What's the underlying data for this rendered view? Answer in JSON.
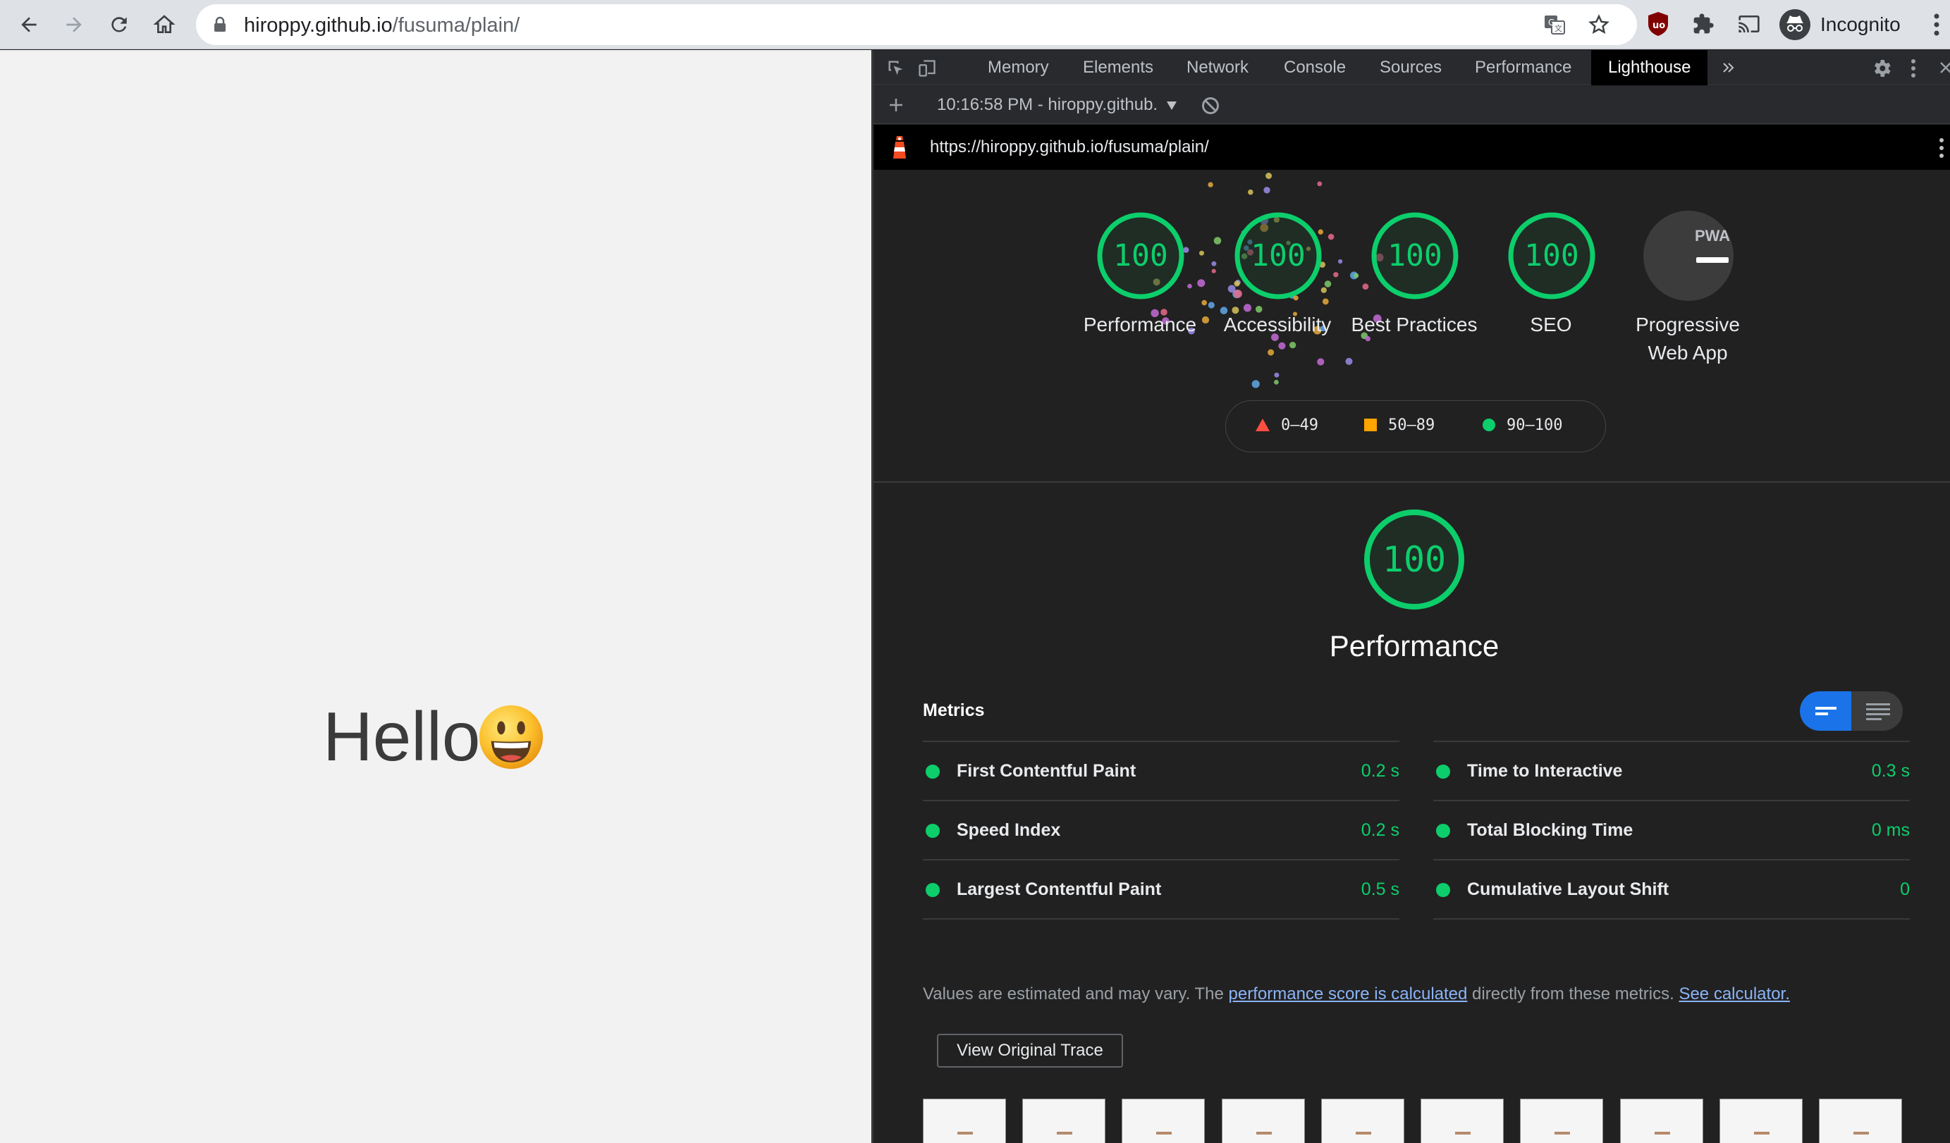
{
  "browser": {
    "url_host": "hiroppy.github.io",
    "url_path": "/fusuma/plain/",
    "profile_label": "Incognito"
  },
  "page": {
    "greeting": "Hello",
    "emoji_icon": "grinning-face-icon"
  },
  "devtools": {
    "tabs": [
      {
        "label": "Memory"
      },
      {
        "label": "Elements"
      },
      {
        "label": "Network"
      },
      {
        "label": "Console"
      },
      {
        "label": "Sources"
      },
      {
        "label": "Performance"
      },
      {
        "label": "Lighthouse",
        "active": true
      }
    ],
    "report_selector": "10:16:58 PM - hiroppy.github.",
    "lighthouse_url": "https://hiroppy.github.io/fusuma/plain/"
  },
  "lighthouse": {
    "gauges": [
      {
        "score": "100",
        "label": "Performance"
      },
      {
        "score": "100",
        "label": "Accessibility"
      },
      {
        "score": "100",
        "label": "Best Practices"
      },
      {
        "score": "100",
        "label": "SEO"
      },
      {
        "score": null,
        "label": "Progressive Web App",
        "badge_text": "PWA"
      }
    ],
    "legend": [
      {
        "range": "0–49",
        "shape": "triangle",
        "color": "#ff4e42"
      },
      {
        "range": "50–89",
        "shape": "square",
        "color": "#ffa400"
      },
      {
        "range": "90–100",
        "shape": "circle",
        "color": "#0cce6b"
      }
    ],
    "category": {
      "score": "100",
      "title": "Performance"
    },
    "metrics_title": "Metrics",
    "metrics": [
      {
        "label": "First Contentful Paint",
        "value": "0.2 s"
      },
      {
        "label": "Time to Interactive",
        "value": "0.3 s"
      },
      {
        "label": "Speed Index",
        "value": "0.2 s"
      },
      {
        "label": "Total Blocking Time",
        "value": "0 ms"
      },
      {
        "label": "Largest Contentful Paint",
        "value": "0.5 s"
      },
      {
        "label": "Cumulative Layout Shift",
        "value": "0"
      }
    ],
    "note": {
      "prefix": "Values are estimated and may vary. The ",
      "link1": "performance score is calculated",
      "middle": " directly from these metrics. ",
      "link2": "See calculator."
    },
    "view_trace_label": "View Original Trace",
    "pass_color": "#0cce6b"
  }
}
